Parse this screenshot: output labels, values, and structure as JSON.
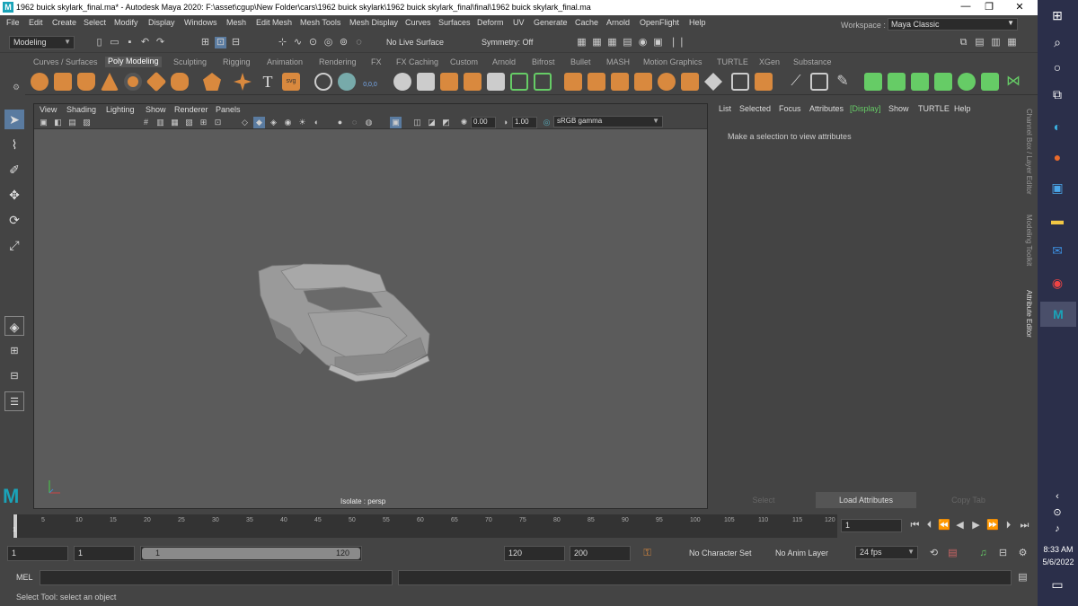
{
  "window": {
    "title": "1962 buick skylark_final.ma* - Autodesk Maya 2020: F:\\asset\\cgup\\New Folder\\cars\\1962 buick skylark\\1962 buick skylark_final\\final\\1962 buick skylark_final.ma",
    "minimize": "—",
    "restore": "❐",
    "close": "✕"
  },
  "menubar": {
    "items": [
      "File",
      "Edit",
      "Create",
      "Select",
      "Modify",
      "Display",
      "Windows",
      "Mesh",
      "Edit Mesh",
      "Mesh Tools",
      "Mesh Display",
      "Curves",
      "Surfaces",
      "Deform",
      "UV",
      "Generate",
      "Cache",
      "Arnold",
      "OpenFlight",
      "Help"
    ],
    "workspace_label": "Workspace :",
    "workspace_value": "Maya Classic"
  },
  "statusline": {
    "mode": "Modeling",
    "live_surface": "No Live Surface",
    "symmetry": "Symmetry: Off"
  },
  "shelf_tabs": {
    "items": [
      "Curves / Surfaces",
      "Poly Modeling",
      "Sculpting",
      "Rigging",
      "Animation",
      "Rendering",
      "FX",
      "FX Caching",
      "Custom",
      "Arnold",
      "Bifrost",
      "Bullet",
      "MASH",
      "Motion Graphics",
      "TURTLE",
      "XGen",
      "Substance"
    ],
    "active": "Poly Modeling"
  },
  "viewport": {
    "menu": [
      "View",
      "Shading",
      "Lighting",
      "Show",
      "Renderer",
      "Panels"
    ],
    "exposure": "0.00",
    "gamma": "1.00",
    "color_space": "sRGB gamma",
    "camera_label": "Isolate : persp"
  },
  "attribute_editor": {
    "menu": [
      "List",
      "Selected",
      "Focus",
      "Attributes",
      "[Display]",
      "Show",
      "TURTLE",
      "Help"
    ],
    "message": "Make a selection to view attributes",
    "buttons": [
      "Select",
      "Load Attributes",
      "Copy Tab"
    ]
  },
  "side_tabs": [
    "Channel Box / Layer Editor",
    "Modeling Toolkit",
    "Attribute Editor"
  ],
  "timeline": {
    "ticks": [
      "5",
      "10",
      "15",
      "20",
      "25",
      "30",
      "35",
      "40",
      "45",
      "50",
      "55",
      "60",
      "65",
      "70",
      "75",
      "80",
      "85",
      "90",
      "95",
      "100",
      "105",
      "110",
      "115",
      "120"
    ],
    "current_frame": "1",
    "frame_field": "1"
  },
  "range": {
    "start": "1",
    "playback_start": "1",
    "slider_start": "1",
    "slider_end": "120",
    "playback_end": "120",
    "end": "200",
    "character_set": "No Character Set",
    "anim_layer": "No Anim Layer",
    "fps": "24 fps"
  },
  "command_line": {
    "label": "MEL"
  },
  "help_line": {
    "text": "Select Tool: select an object"
  },
  "taskbar": {
    "time": "8:33 AM",
    "date": "5/6/2022"
  }
}
